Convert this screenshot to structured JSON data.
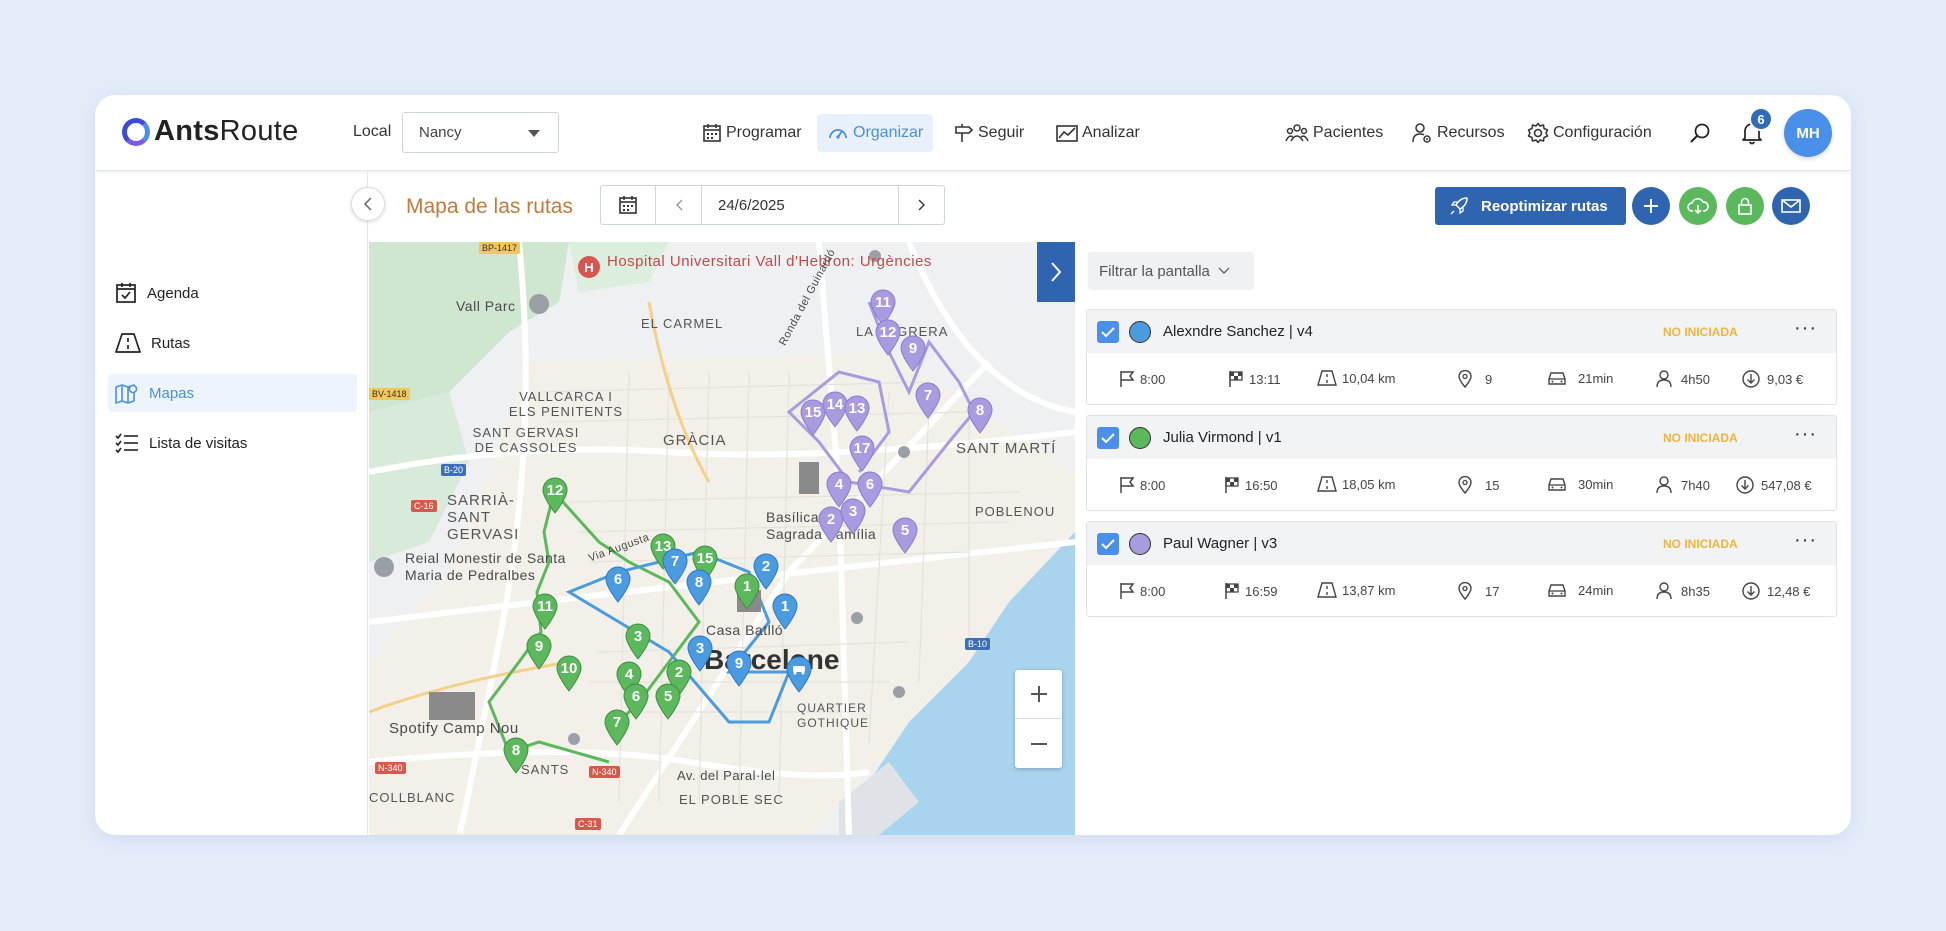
{
  "app": {
    "logo_text": "AntsRoute",
    "logo_bold": "Ants",
    "logo_rest": "Route"
  },
  "header": {
    "local_label": "Local",
    "local_value": "Nancy",
    "nav": [
      {
        "label": "Programar",
        "icon": "calendar-icon"
      },
      {
        "label": "Organizar",
        "icon": "gauge-icon",
        "active": true
      },
      {
        "label": "Seguir",
        "icon": "signpost-icon"
      },
      {
        "label": "Analizar",
        "icon": "chart-icon"
      }
    ],
    "right": [
      {
        "label": "Pacientes",
        "icon": "patients-icon"
      },
      {
        "label": "Recursos",
        "icon": "resources-icon"
      },
      {
        "label": "Configuración",
        "icon": "gear-icon"
      }
    ],
    "notifications": "6",
    "avatar": "MH"
  },
  "sidebar": {
    "items": [
      {
        "label": "Agenda",
        "icon": "calendar-check-icon"
      },
      {
        "label": "Rutas",
        "icon": "road-icon"
      },
      {
        "label": "Mapas",
        "icon": "map-icon",
        "active": true
      },
      {
        "label": "Lista de visitas",
        "icon": "list-icon"
      }
    ]
  },
  "toolbar": {
    "title": "Mapa de las rutas",
    "date": "24/6/2025",
    "reoptimize": "Reoptimizar rutas"
  },
  "colors": {
    "primary": "#2f65b0",
    "blue_route": "#4a9be0",
    "green_route": "#5cb85c",
    "purple_route": "#a89be0",
    "status": "#f0b43c"
  },
  "filter": {
    "label": "Filtrar la pantalla"
  },
  "routes": [
    {
      "name": "Alexndre Sanchez | v4",
      "color": "#4a9be0",
      "status": "NO INICIADA",
      "start": "8:00",
      "end": "13:11",
      "distance": "10,04 km",
      "stops": "9",
      "drive": "21min",
      "time": "4h50",
      "cost": "9,03 €"
    },
    {
      "name": "Julia Virmond | v1",
      "color": "#5cb85c",
      "status": "NO INICIADA",
      "start": "8:00",
      "end": "16:50",
      "distance": "18,05 km",
      "stops": "15",
      "drive": "30min",
      "time": "7h40",
      "cost": "547,08 €"
    },
    {
      "name": "Paul Wagner | v3",
      "color": "#a89be0",
      "status": "NO INICIADA",
      "start": "8:00",
      "end": "16:59",
      "distance": "13,87 km",
      "stops": "17",
      "drive": "24min",
      "time": "8h35",
      "cost": "12,48 €"
    }
  ],
  "map": {
    "labels": {
      "hospital": "Hospital Universitari Vall d'Hebron: Urgències",
      "vall_parc": "Vall Parc",
      "el_carmel": "EL CARMEL",
      "la_sagrera": "LA SAGRERA",
      "vallcarca": "VALLCARCA I ELS PENITENTS",
      "sant_gervasi": "SANT GERVASI DE CASSOLES",
      "gracia": "GRÀCIA",
      "sant_marti": "SANT MARTÍ",
      "sarria": "SARRIÀ-SANT GERVASI",
      "poblenou": "POBLENOU",
      "reial": "Reial Monestir de Santa Maria de Pedralbes",
      "basilica": "Basílica de la Sagrada Família",
      "casa_batllo": "Casa Batlló",
      "barcelone": "Barcelone",
      "quartier": "QUARTIER GOTHIQUE",
      "spotify": "Spotify Camp Nou",
      "sants": "SANTS",
      "paral": "Av. del Paral·lel",
      "poble_sec": "EL POBLE SEC",
      "collblanc": "COLLBLANC",
      "ronda": "Ronda del Guinardó",
      "via_augusta": "Via Augusta"
    },
    "roads": [
      "BP-1417",
      "BV-1418",
      "B-20",
      "C-16",
      "B-10",
      "N-340",
      "N-340",
      "C-31"
    ],
    "pins": {
      "purple": [
        "11",
        "12",
        "9",
        "7",
        "8",
        "15",
        "14",
        "13",
        "17",
        "4",
        "6",
        "2",
        "3",
        "5"
      ],
      "green": [
        "12",
        "13",
        "15",
        "1",
        "11",
        "9",
        "10",
        "3",
        "4",
        "2",
        "6",
        "5",
        "7",
        "8"
      ],
      "blue": [
        "6",
        "7",
        "8",
        "2",
        "1",
        "3",
        "9"
      ]
    }
  }
}
